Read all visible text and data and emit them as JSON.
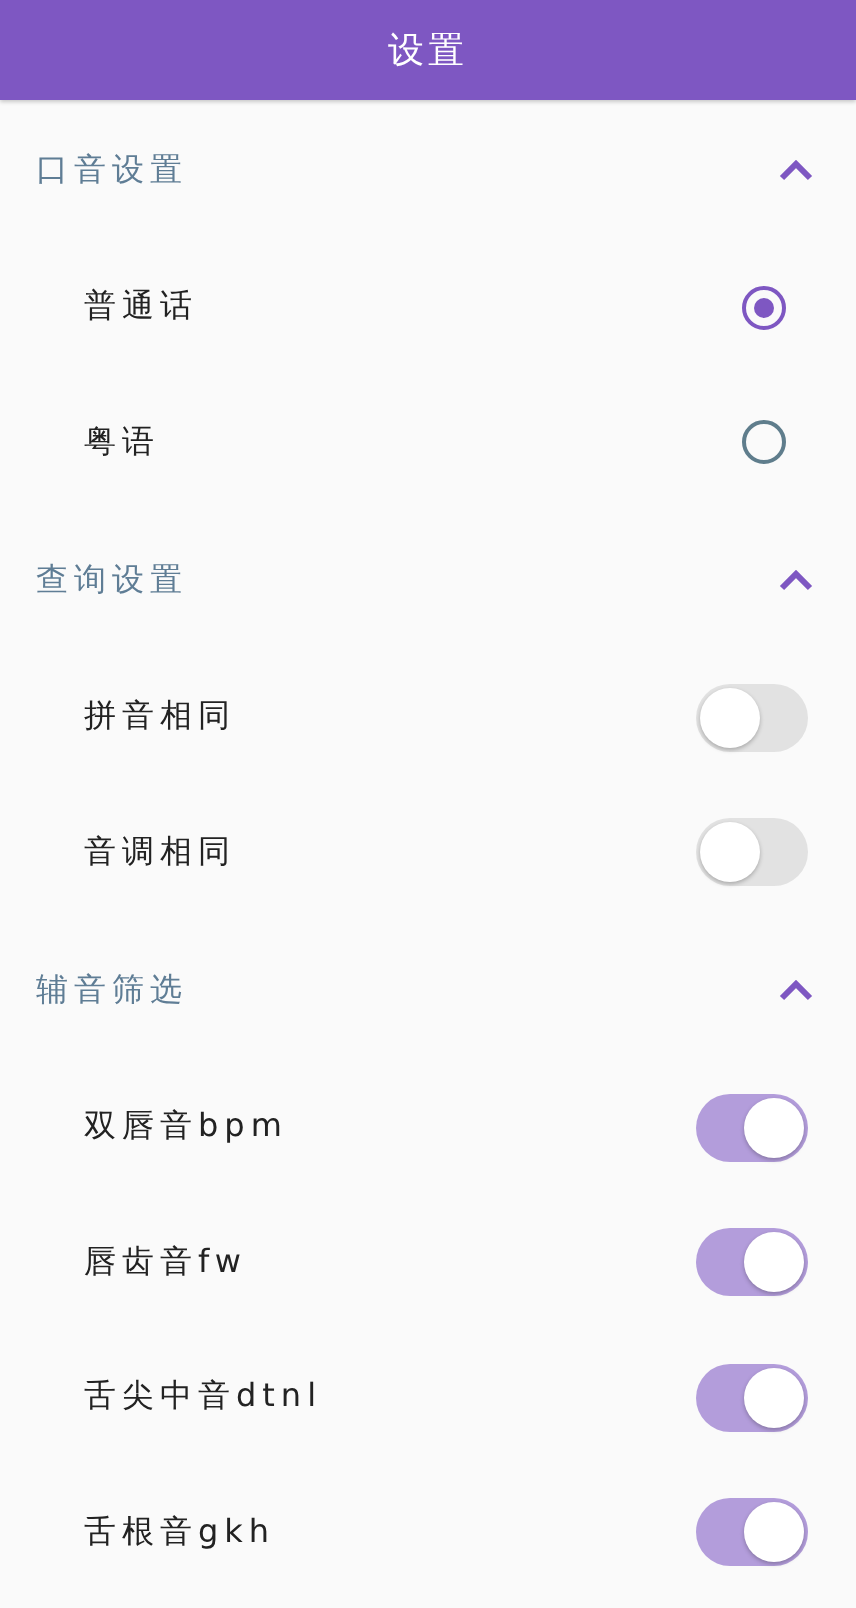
{
  "app_bar": {
    "title": "设置"
  },
  "sections": [
    {
      "title": "口音设置",
      "expanded": true,
      "items": [
        {
          "kind": "radio",
          "label": "普通话",
          "selected": true
        },
        {
          "kind": "radio",
          "label": "粤语",
          "selected": false
        }
      ]
    },
    {
      "title": "查询设置",
      "expanded": true,
      "items": [
        {
          "kind": "switch",
          "label": "拼音相同",
          "on": false
        },
        {
          "kind": "switch",
          "label": "音调相同",
          "on": false
        }
      ]
    },
    {
      "title": "辅音筛选",
      "expanded": true,
      "items": [
        {
          "kind": "switch",
          "label": "双唇音bpm",
          "on": true
        },
        {
          "kind": "switch",
          "label": "唇齿音fw",
          "on": true
        },
        {
          "kind": "switch",
          "label": "舌尖中音dtnl",
          "on": true
        },
        {
          "kind": "switch",
          "label": "舌根音gkh",
          "on": true
        }
      ]
    }
  ]
}
